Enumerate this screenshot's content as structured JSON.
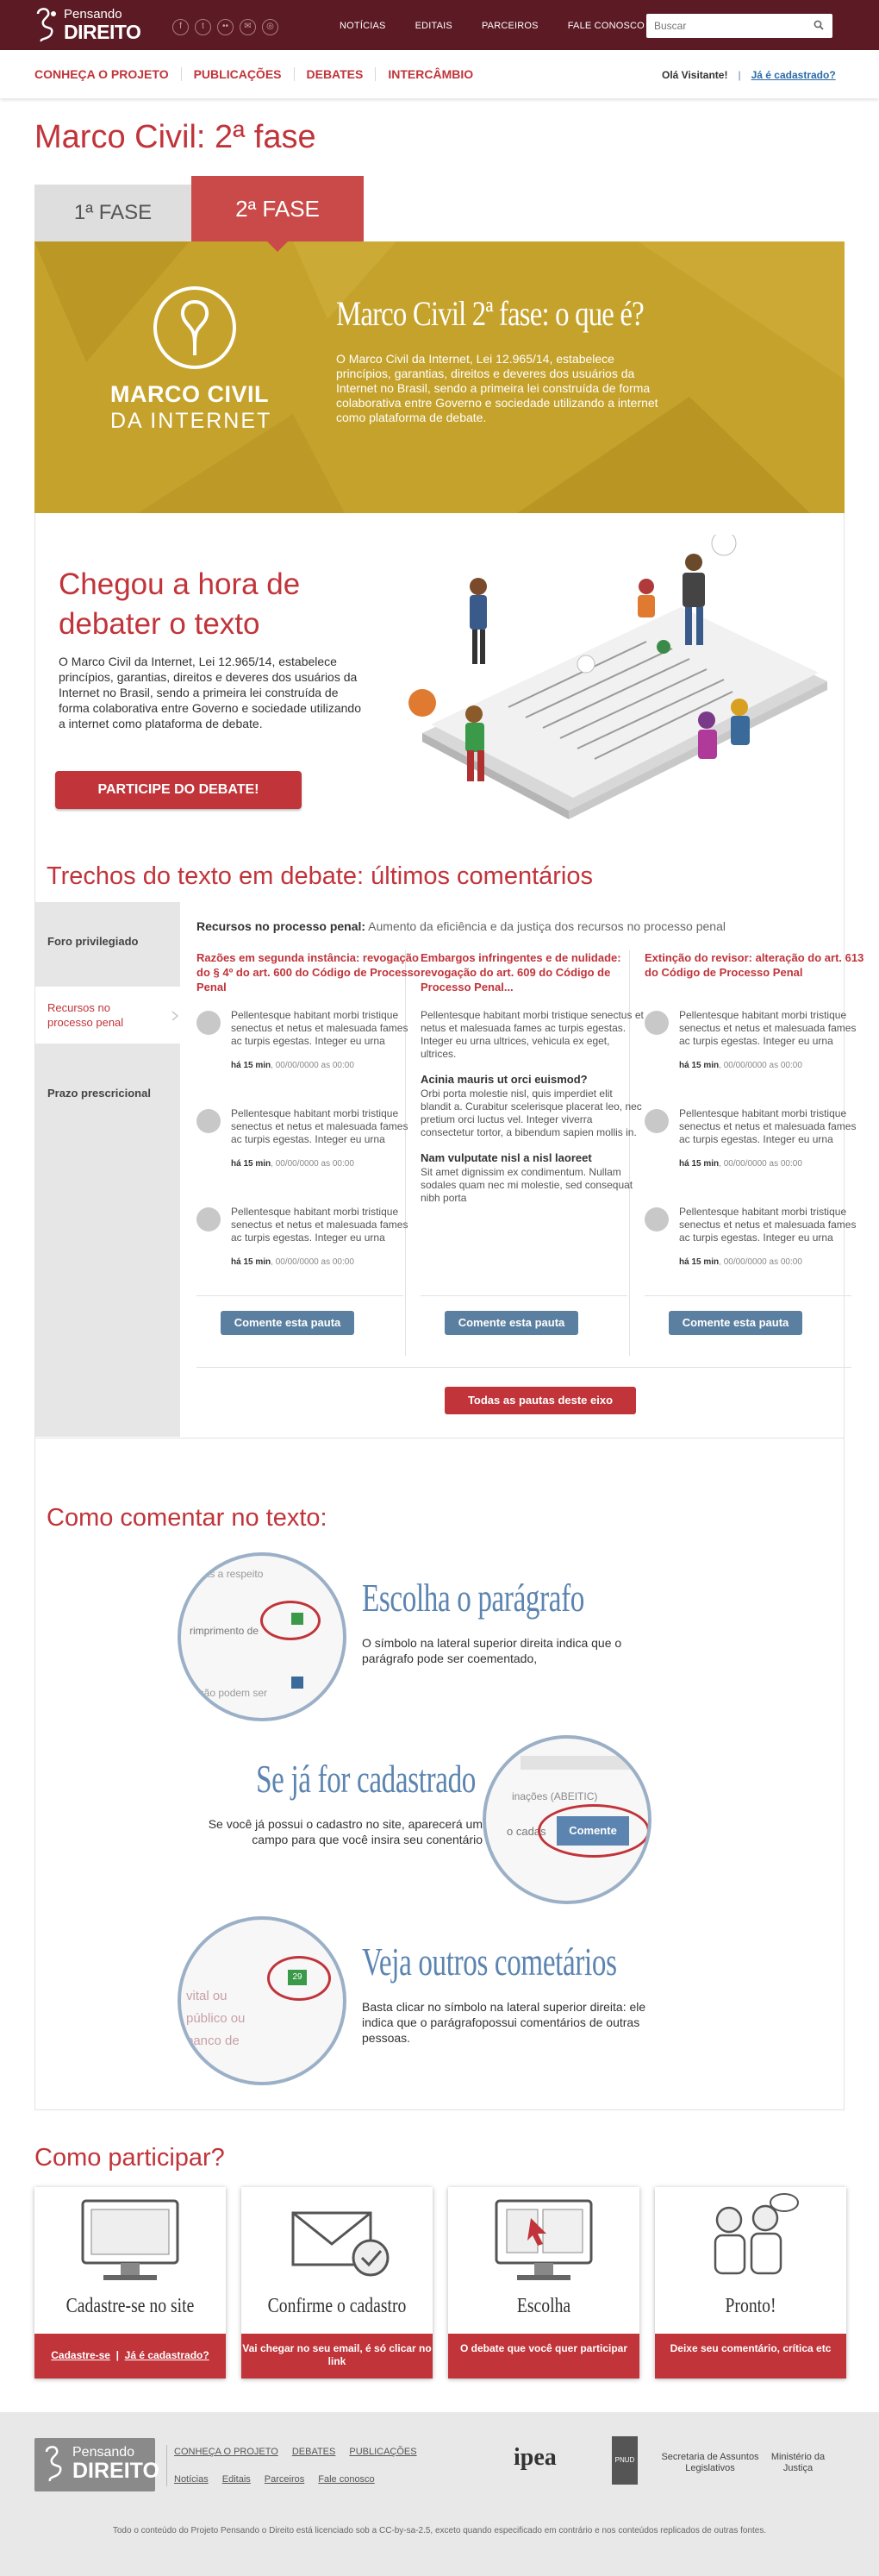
{
  "header": {
    "logo_line1": "Pensando",
    "logo_line2": "DIREITO",
    "nav": [
      "NOTÍCIAS",
      "EDITAIS",
      "PARCEIROS",
      "FALE CONOSCO"
    ],
    "search_placeholder": "Buscar"
  },
  "subnav": {
    "menu": [
      "CONHEÇA O PROJETO",
      "PUBLICAÇÕES",
      "DEBATES",
      "INTERCÂMBIO"
    ],
    "welcome": "Olá Visitante!",
    "separator": "|",
    "register": "Já é cadastrado?"
  },
  "page_title": "Marco Civil: 2ª fase",
  "tabs": [
    "1ª FASE",
    "2ª FASE"
  ],
  "hero": {
    "logo_line1": "MARCO CIVIL",
    "logo_line2": "DA INTERNET",
    "title": "Marco Civil 2ª fase: o que é?",
    "text": "O Marco Civil da Internet, Lei 12.965/14, estabelece princípios, garantias, direitos e deveres dos usuários da Internet no Brasil, sendo a primeira lei construída de forma colaborativa entre Governo e sociedade utilizando a internet como plataforma de debate."
  },
  "debate": {
    "heading": "Chegou a hora de debater o texto",
    "text": "O Marco Civil da Internet, Lei 12.965/14, estabelece princípios, garantias, direitos e deveres dos usuários da Internet no Brasil, sendo a primeira lei construída de forma colaborativa entre Governo e sociedade utilizando a internet como plataforma de debate.",
    "button": "PARTICIPE DO DEBATE!"
  },
  "trechos": {
    "heading": "Trechos do texto em debate: últimos comentários",
    "menu": [
      "Foro privilegiado",
      "Recursos no processo penal",
      "Prazo prescricional"
    ],
    "topic_label": "Recursos no processo penal:",
    "topic_desc": " Aumento da eficiência e da justiça dos recursos no processo penal",
    "columns": [
      {
        "title": "Razões em segunda instância: revogação do § 4º do art. 600 do Código de Processo Penal",
        "comments": [
          {
            "text": "Pellentesque habitant morbi tristique senectus et netus et malesuada fames ac turpis egestas. Integer eu urna",
            "ago": "há 15 min",
            "date": ", 00/00/0000 as 00:00"
          },
          {
            "text": "Pellentesque habitant morbi tristique senectus et netus et malesuada fames ac turpis egestas. Integer eu urna",
            "ago": "há 15 min",
            "date": ", 00/00/0000 as 00:00"
          },
          {
            "text": "Pellentesque habitant morbi tristique senectus et netus et malesuada fames ac turpis egestas. Integer eu urna",
            "ago": "há 15 min",
            "date": ", 00/00/0000 as 00:00"
          }
        ],
        "button": "Comente esta pauta"
      },
      {
        "title": "Embargos infringentes e de nulidade: revogação do art. 609 do Código de Processo Penal...",
        "blocks": [
          {
            "heading": "",
            "text": "Pellentesque habitant morbi tristique senectus et netus et malesuada fames ac turpis egestas. Integer eu urna ultrices, vehicula ex eget, ultrices."
          },
          {
            "heading": "Acinia mauris ut orci euismod?",
            "text": "Orbi porta molestie nisl, quis imperdiet elit blandit a. Curabitur scelerisque placerat leo, nec pretium orci luctus vel. Integer viverra consectetur tortor, a bibendum sapien mollis in."
          },
          {
            "heading": "Nam vulputate nisl a nisl laoreet",
            "text": "Sit amet dignissim ex condimentum. Nullam sodales quam nec mi molestie, sed consequat nibh porta"
          }
        ],
        "button": "Comente esta pauta"
      },
      {
        "title": "Extinção do revisor: alteração do art. 613 do Código de Processo Penal",
        "comments": [
          {
            "text": "Pellentesque habitant morbi tristique senectus et netus et malesuada fames ac turpis egestas. Integer eu urna",
            "ago": "há 15 min",
            "date": ", 00/00/0000 as 00:00"
          },
          {
            "text": "Pellentesque habitant morbi tristique senectus et netus et malesuada fames ac turpis egestas. Integer eu urna",
            "ago": "há 15 min",
            "date": ", 00/00/0000 as 00:00"
          },
          {
            "text": "Pellentesque habitant morbi tristique senectus et netus et malesuada fames ac turpis egestas. Integer eu urna",
            "ago": "há 15 min",
            "date": ", 00/00/0000 as 00:00"
          }
        ],
        "button": "Comente esta pauta"
      }
    ],
    "all_button": "Todas as pautas deste eixo"
  },
  "como_comentar": {
    "heading": "Como comentar no texto:",
    "steps": [
      {
        "title": "Escolha o parágrafo",
        "text": "O símbolo na lateral superior direita indica que o parágrafo pode ser coementado,",
        "snippet1": "nas a respeito",
        "snippet2": "rimprimento de",
        "snippet3": "não podem ser"
      },
      {
        "title": "Se já for cadastrado",
        "text": "Se você já possui o cadastro no site, aparecerá um campo para que você insira seu conentário",
        "snippet1": "inações (ABEITIC)",
        "snippet2": "o cadas",
        "button": "Comente"
      },
      {
        "title": "Veja outros cometários",
        "text": "Basta clicar no símbolo na lateral superior direita: ele indica que o parágrafopossui comentários de outras pessoas.",
        "snippet1": "vital ou",
        "snippet2": "público ou",
        "snippet3": "banco de",
        "badge": "29"
      }
    ]
  },
  "participar": {
    "heading": "Como participar?",
    "cards": [
      {
        "title": "Cadastre-se no site",
        "link1": "Cadastre-se",
        "sep": "|",
        "link2": "Já é cadastrado?"
      },
      {
        "title": "Confirme o cadastro",
        "text": "Vai chegar no seu email, é só clicar no link"
      },
      {
        "title": "Escolha",
        "text": "O debate que você quer participar"
      },
      {
        "title": "Pronto!",
        "text": "Deixe seu comentário, crítica etc"
      }
    ]
  },
  "footer": {
    "logo_line1": "Pensando",
    "logo_line2": "DIREITO",
    "nav1": [
      "CONHEÇA O PROJETO",
      "DEBATES",
      "PUBLICAÇÕES"
    ],
    "nav2": [
      "Notícias",
      "Editais",
      "Parceiros",
      "Fale conosco"
    ],
    "partners": [
      "ipea",
      "PNUD",
      "Secretaria de Assuntos Legislativos",
      "Ministério da Justiça"
    ],
    "copyright": "Todo o conteúdo do Projeto Pensando o Direito está licenciado sob a CC-by-sa-2.5, exceto quando especificado em contrário e nos conteúdos replicados de outras fontes."
  },
  "colors": {
    "brand_dark": "#5b1a24",
    "accent_red": "#c0343a",
    "hero_gold": "#c5a22c",
    "steel_blue": "#5b7fa0"
  }
}
